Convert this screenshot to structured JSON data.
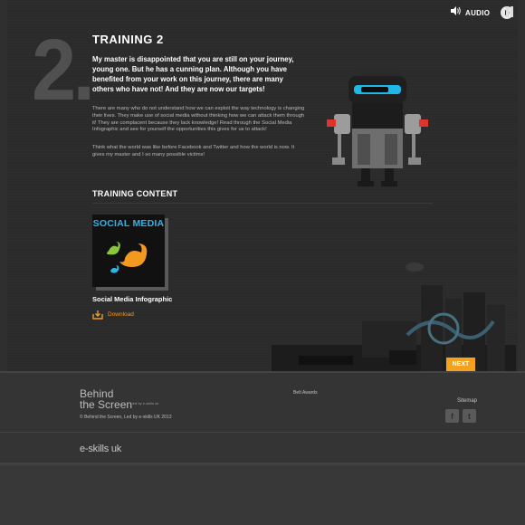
{
  "audio": {
    "label": "AUDIO"
  },
  "step": {
    "number": "2."
  },
  "training": {
    "title": "TRAINING 2",
    "lead": "My master is disappointed that you are still on your journey, young one. But he has a cunning plan. Although you have benefited from your work on this journey, there are many others who have not! And they are now our targets!",
    "paragraph1": "There are many who do not understand how we can exploit the way technology is changing their lives. They make use of social media without thinking how we can attack them through it! They are complacent because they lack knowledge! Read through the Social Media Infographic and see for yourself the opportunities this gives for us to attack!",
    "paragraph2": "Think what the world was like before Facebook and Twitter and how the world is now. It gives my master and I so many possible victims!"
  },
  "content": {
    "section_title": "TRAINING CONTENT",
    "items": [
      {
        "thumb_title": "SOCIAL MEDIA",
        "title": "Social Media Infographic",
        "download_label": "Download"
      }
    ]
  },
  "nav": {
    "next_label": "NEXT"
  },
  "footer": {
    "logo_line1": "Behind",
    "logo_line2": "the Screen",
    "logo_small": "led by e-skills uk",
    "copyright": "© Behind the Screen, Led by e-skills UK 2013",
    "awards": "BeIt Awards",
    "sitemap": "Sitemap",
    "facebook_glyph": "f",
    "twitter_glyph": "t",
    "eskills_logo": "e-skills uk"
  },
  "colors": {
    "accent": "#f6a11c",
    "social_blue": "#2fb4e6",
    "twitter_orange": "#f29a1f",
    "robot_visor": "#1fb6e8"
  }
}
